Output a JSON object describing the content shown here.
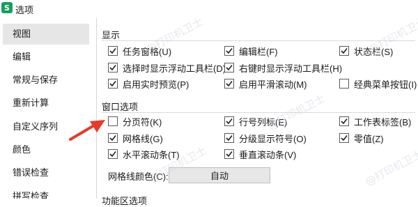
{
  "window": {
    "app_icon_letter": "S",
    "title": "选项"
  },
  "sidebar": {
    "items": [
      {
        "label": "视图",
        "selected": true
      },
      {
        "label": "编辑"
      },
      {
        "label": "常规与保存"
      },
      {
        "label": "重新计算"
      },
      {
        "label": "自定义序列"
      },
      {
        "label": "颜色"
      },
      {
        "label": "错误检查"
      },
      {
        "label": "拼写检查"
      }
    ]
  },
  "display_section": {
    "heading": "显示",
    "options": [
      {
        "label": "任务窗格(U)",
        "checked": true
      },
      {
        "label": "编辑栏(F)",
        "checked": true
      },
      {
        "label": "状态栏(S)",
        "checked": true
      },
      {
        "label": "选择时显示浮动工具栏(D)",
        "checked": true
      },
      {
        "label": "右键时显示浮动工具栏(H)",
        "checked": true
      },
      {
        "label": "启用实时预览(P)",
        "checked": true
      },
      {
        "label": "启用平滑滚动(M)",
        "checked": true
      },
      {
        "label": "经典菜单按钮(I)",
        "checked": false
      }
    ]
  },
  "window_section": {
    "heading": "窗口选项",
    "options": [
      {
        "label": "分页符(K)",
        "checked": false
      },
      {
        "label": "行号列标(E)",
        "checked": true
      },
      {
        "label": "工作表标签(B)",
        "checked": true
      },
      {
        "label": "网格线(G)",
        "checked": true
      },
      {
        "label": "分级显示符号(O)",
        "checked": true
      },
      {
        "label": "零值(Z)",
        "checked": true
      },
      {
        "label": "水平滚动条(T)",
        "checked": true
      },
      {
        "label": "垂直滚动条(V)",
        "checked": true
      }
    ],
    "gridline_color_label": "网格线颜色(C):",
    "gridline_color_value": "自动"
  },
  "next_section_heading": "功能区选项",
  "watermark_text": "@打印机卫士",
  "colors": {
    "arrow": "#e8392a",
    "app_icon": "#13a05a",
    "selected_item": "#e6e6e6"
  }
}
